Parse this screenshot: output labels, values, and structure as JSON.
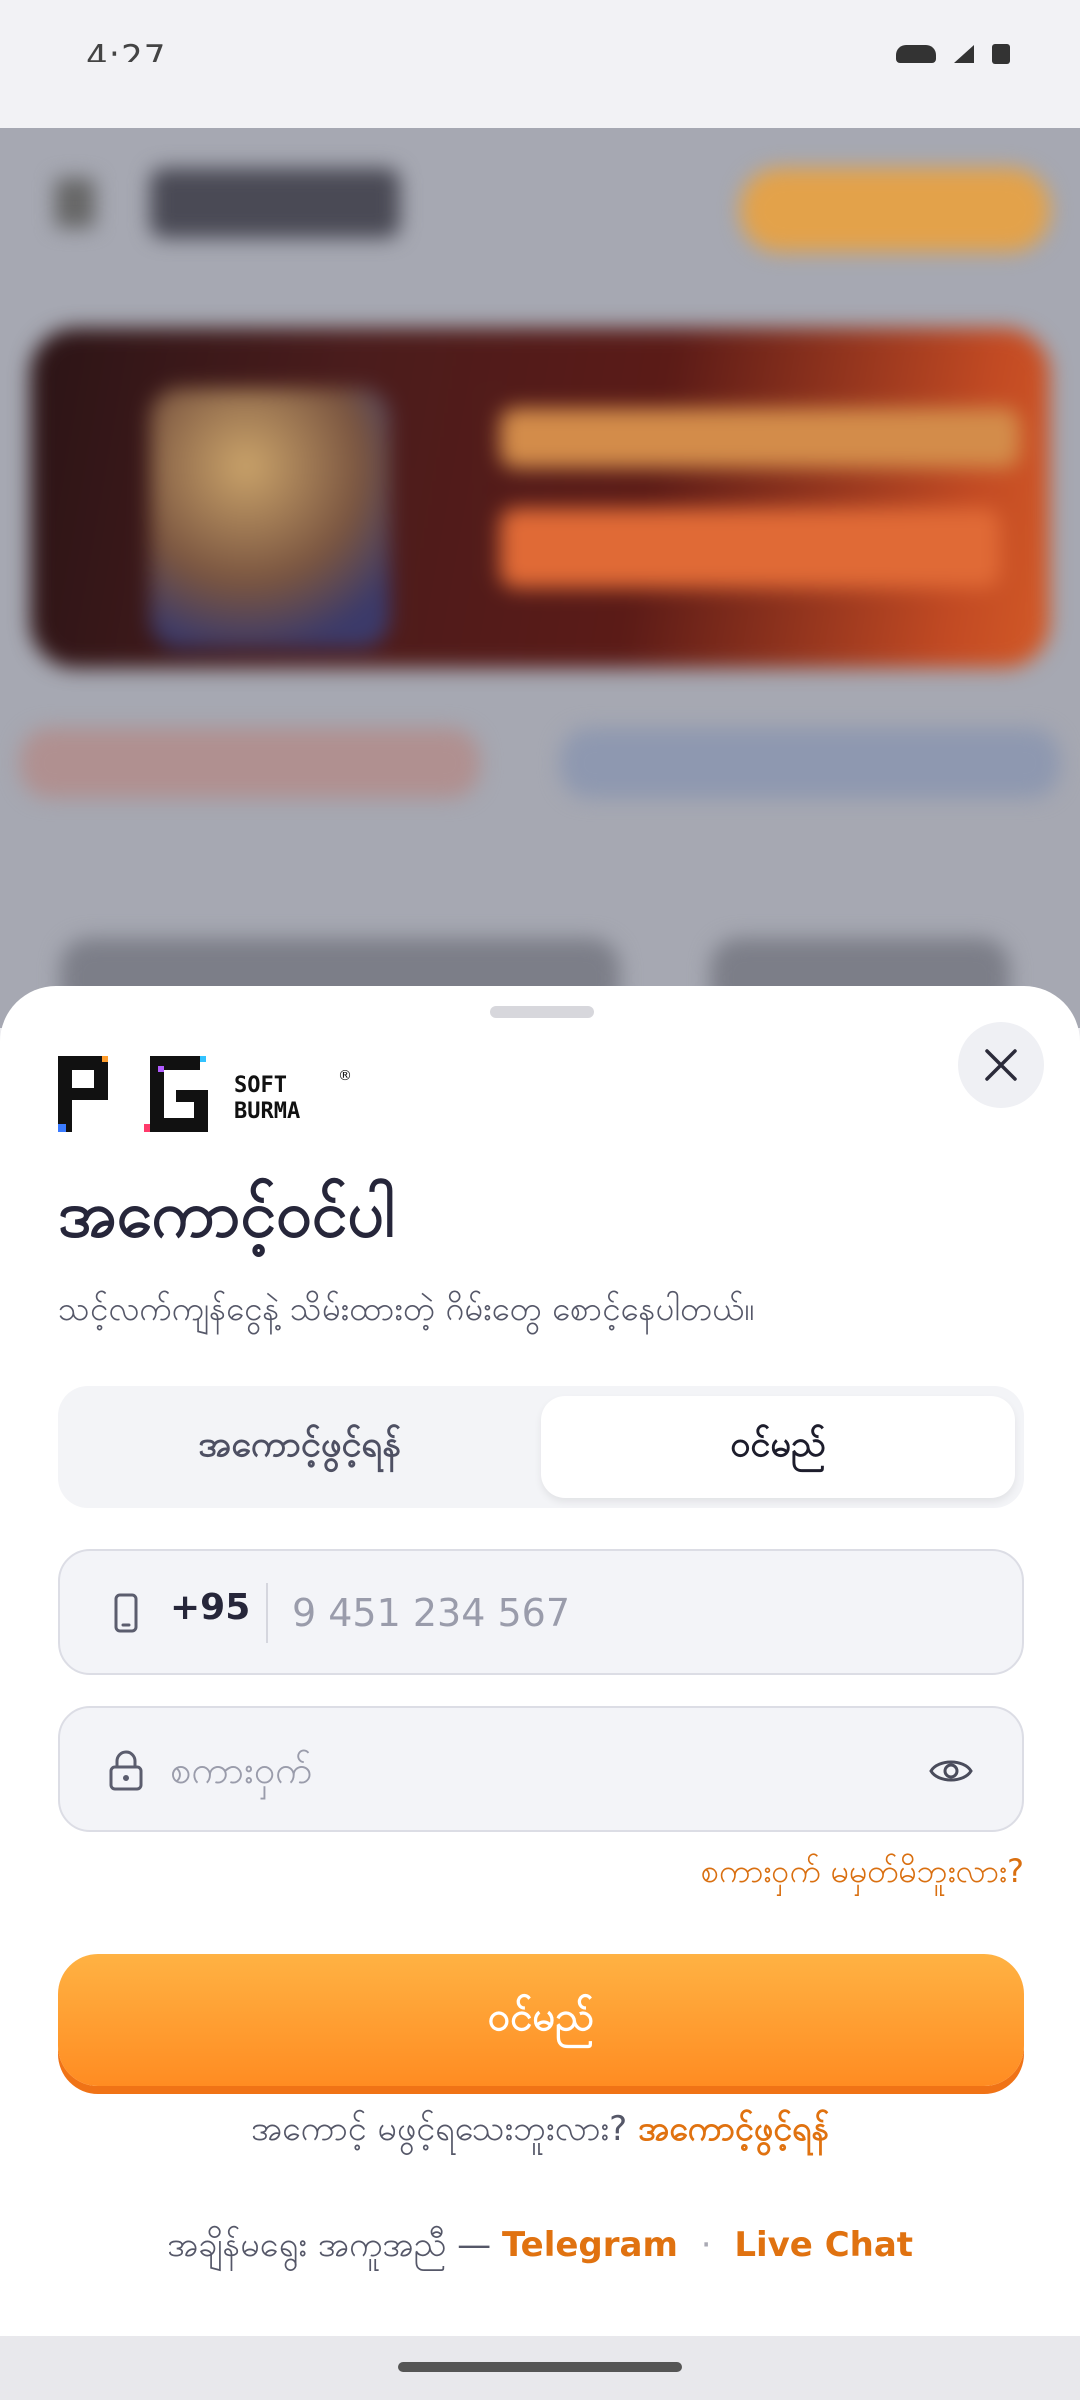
{
  "status_bar": {
    "time": "4:27"
  },
  "sheet": {
    "logo": {
      "main": "PG",
      "sub_top": "SOFT",
      "sub_bottom": "BURMA",
      "mark": "®"
    },
    "title": "အကောင့်ဝင်ပါ",
    "subtitle": "သင့်လက်ကျန်ငွေနဲ့ သိမ်းထားတဲ့ ဂိမ်းတွေ စောင့်နေပါတယ်။",
    "tabs": [
      {
        "label": "အကောင့်ဖွင့်ရန်",
        "active": false
      },
      {
        "label": "ဝင်မည်",
        "active": true
      }
    ],
    "phone": {
      "country_code": "+95",
      "placeholder": "9 451 234 567",
      "value": ""
    },
    "password": {
      "placeholder": "စကားဝှက်",
      "value": ""
    },
    "forgot_label": "စကားဝှက် မမှတ်မိဘူးလား?",
    "login_button": "ဝင်မည်",
    "no_account": {
      "text": "အကောင့် မဖွင့်ရသေးဘူးလား?",
      "link": "အကောင့်ဖွင့်ရန်"
    },
    "help": {
      "text": "အချိန်မရွေး အကူအညီ —",
      "telegram": "Telegram",
      "separator": "·",
      "live_chat": "Live Chat"
    }
  },
  "colors": {
    "accent": "#FF8C22",
    "link": "#E07210",
    "title": "#26263A"
  },
  "icons": [
    "close-icon",
    "phone-icon",
    "lock-icon",
    "eye-icon"
  ]
}
